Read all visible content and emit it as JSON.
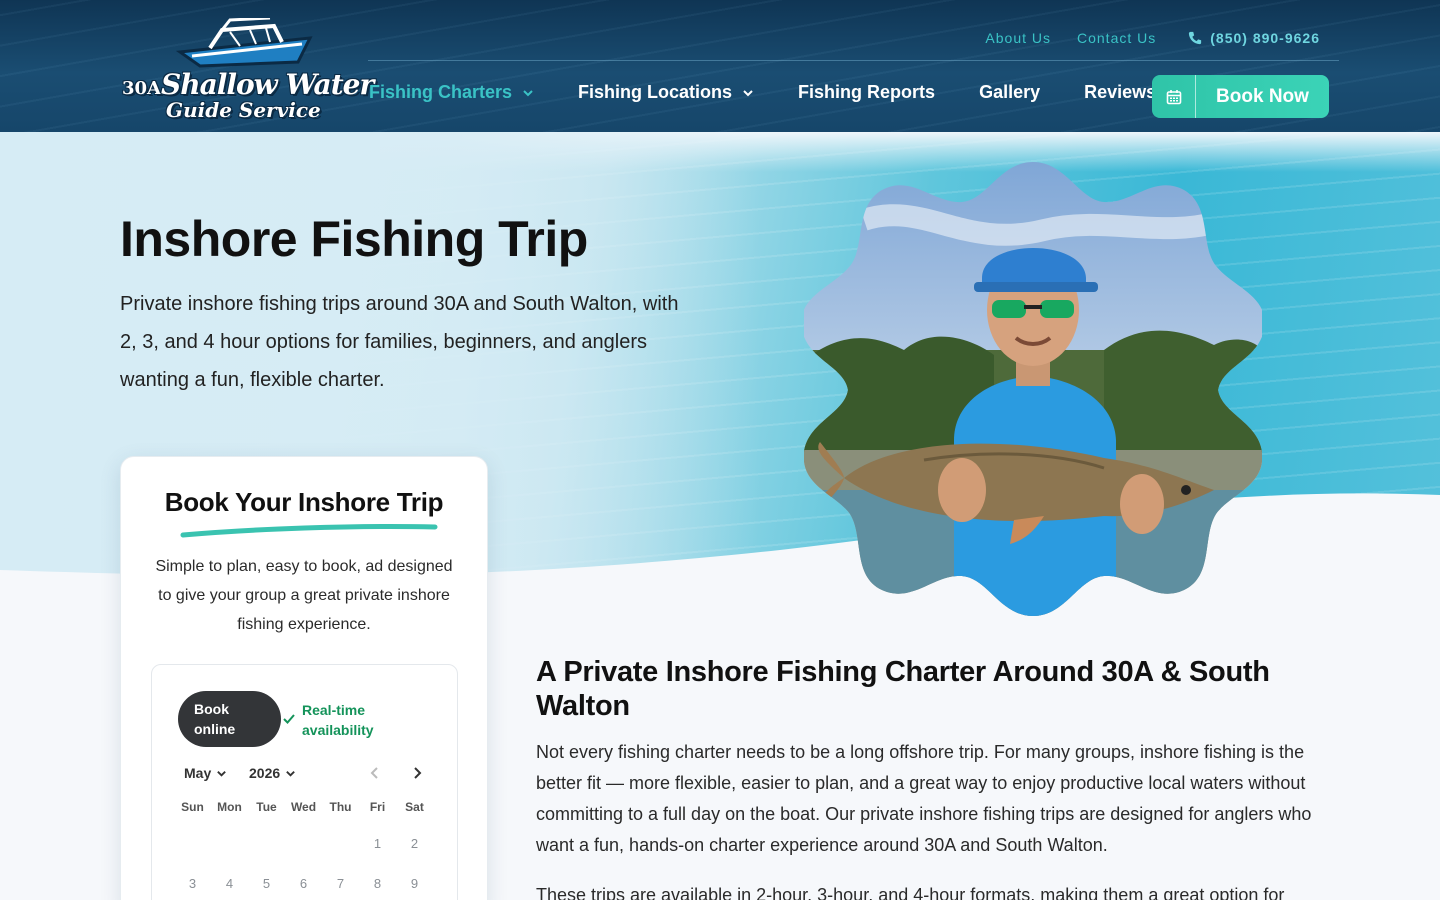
{
  "brand": {
    "logo_prefix": "30A",
    "logo_line1": "Shallow Water",
    "logo_line2": "Guide Service"
  },
  "topbar": {
    "about": "About Us",
    "contact": "Contact Us",
    "phone": "(850) 890-9626"
  },
  "nav": {
    "items": [
      {
        "label": "Fishing Charters",
        "dropdown": true,
        "active": true
      },
      {
        "label": "Fishing Locations",
        "dropdown": true,
        "active": false
      },
      {
        "label": "Fishing Reports",
        "dropdown": false,
        "active": false
      },
      {
        "label": "Gallery",
        "dropdown": false,
        "active": false
      },
      {
        "label": "Reviews",
        "dropdown": false,
        "active": false
      }
    ],
    "cta": "Book Now"
  },
  "hero": {
    "title": "Inshore Fishing Trip",
    "lead": "Private inshore fishing trips around 30A and South Walton, with 2, 3, and 4 hour options for families, beginners, and anglers wanting a fun, flexible charter."
  },
  "booking": {
    "title": "Book Your Inshore Trip",
    "description": "Simple to plan, easy to book, ad designed to give your group a great private inshore fishing experience.",
    "pill_line1": "Book",
    "pill_line2": "online",
    "avail_line1": "Real-time",
    "avail_line2": "availability",
    "month": "May",
    "year": "2026",
    "weekdays": [
      "Sun",
      "Mon",
      "Tue",
      "Wed",
      "Thu",
      "Fri",
      "Sat"
    ],
    "row1": [
      "1",
      "2"
    ],
    "row2": [
      "3",
      "4",
      "5",
      "6",
      "7",
      "8",
      "9"
    ]
  },
  "content": {
    "heading": "A Private Inshore Fishing Charter Around 30A & South Walton",
    "para1": "Not every fishing charter needs to be a long offshore trip. For many groups, inshore fishing is the better fit — more flexible, easier to plan, and a great way to enjoy productive local waters without committing to a full day on the boat. Our private inshore fishing trips are designed for anglers who want a fun, hands-on charter experience around 30A and South Walton.",
    "para2": "These trips are available in 2-hour, 3-hour, and 4-hour formats, making them a great option for"
  },
  "colors": {
    "accent_teal": "#3ac3c6",
    "cta_green": "#2fc4a8",
    "header_navy": "#0f3554",
    "avail_green": "#14935a"
  },
  "icons": [
    "phone-icon",
    "chevron-down-icon",
    "calendar-icon",
    "check-icon",
    "chevron-left-icon",
    "chevron-right-icon"
  ]
}
